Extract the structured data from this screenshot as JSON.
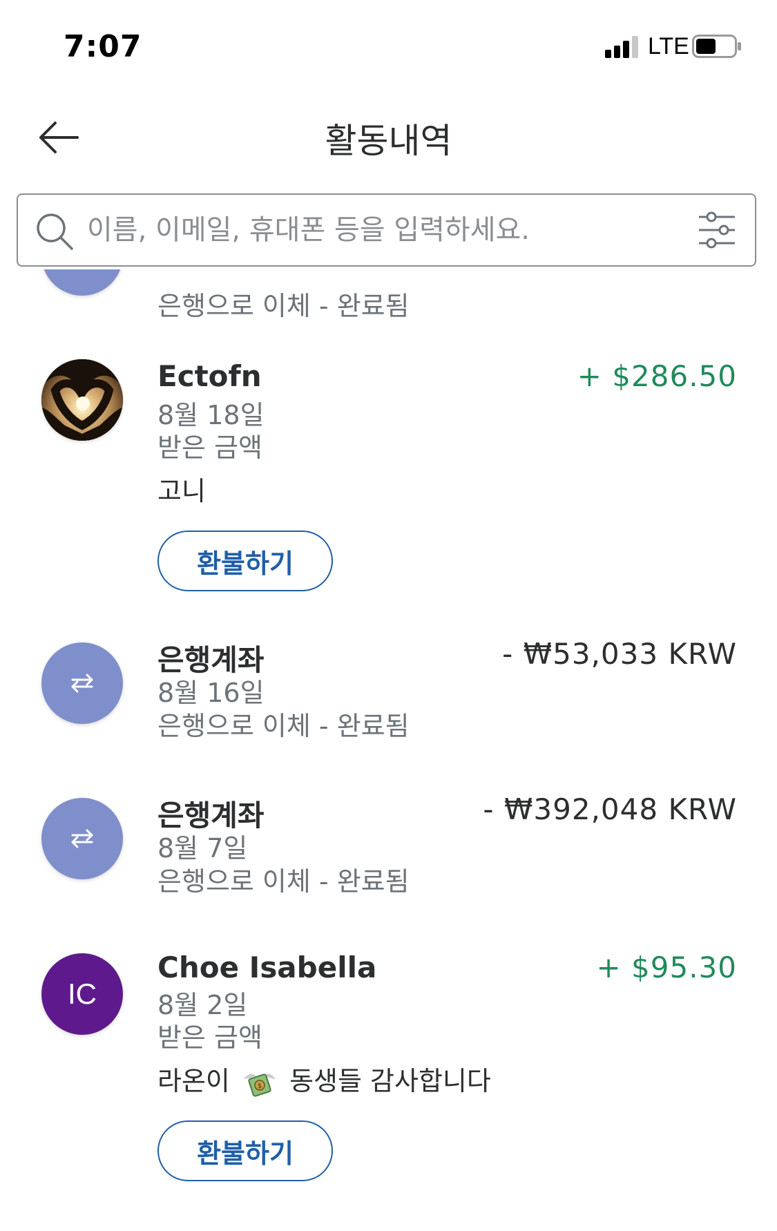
{
  "status_bar": {
    "time": "7:07",
    "network": "LTE"
  },
  "header": {
    "title": "활동내역"
  },
  "search": {
    "placeholder": "이름, 이메일, 휴대폰 등을 입력하세요."
  },
  "colors": {
    "positive": "#218a5b",
    "link": "#1f5fa8",
    "bank_avatar": "#7f8fcb",
    "initials_avatar": "#5e1a8c"
  },
  "transactions": [
    {
      "status": "은행으로 이체 - 완료됨",
      "avatar_type": "bank",
      "avatar_icon": "transfer-arrows-icon"
    },
    {
      "name": "Ectofn",
      "date": "8월 18일",
      "status": "받은 금액",
      "note": "고니",
      "amount": "+ $286.50",
      "direction": "in",
      "refund_label": "환불하기",
      "avatar_type": "photo",
      "avatar_icon": "heart-hands-sunset-photo"
    },
    {
      "name": "은행계좌",
      "date": "8월 16일",
      "status": "은행으로 이체 - 완료됨",
      "amount": "- ₩53,033 KRW",
      "direction": "out",
      "avatar_type": "bank",
      "avatar_icon": "transfer-arrows-icon"
    },
    {
      "name": "은행계좌",
      "date": "8월 7일",
      "status": "은행으로 이체 - 완료됨",
      "amount": "- ₩392,048 KRW",
      "direction": "out",
      "avatar_type": "bank",
      "avatar_icon": "transfer-arrows-icon"
    },
    {
      "name": "Choe Isabella",
      "date": "8월 2일",
      "status": "받은 금액",
      "note_before": "라온이",
      "note_emoji": "money-with-wings-icon",
      "note_after": "동생들 감사합니다",
      "amount": "+ $95.30",
      "direction": "in",
      "refund_label": "환불하기",
      "avatar_type": "initials",
      "initials": "IC"
    }
  ]
}
